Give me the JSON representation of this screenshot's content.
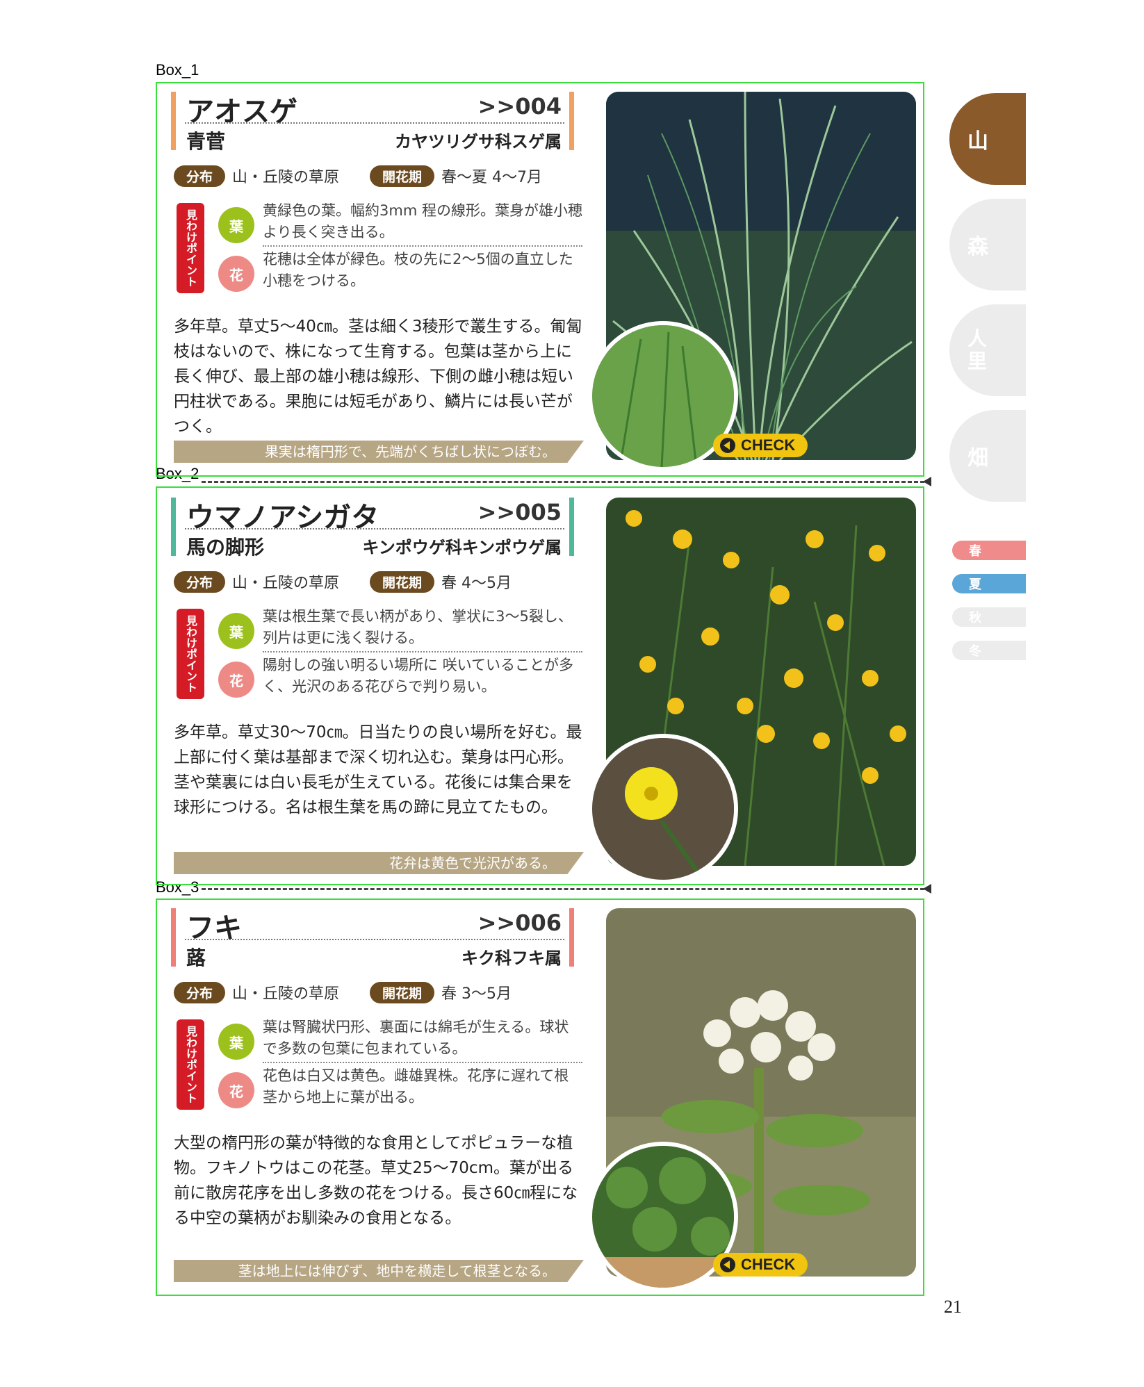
{
  "box_labels": [
    "Box_1",
    "Box_2",
    "Box_3"
  ],
  "common": {
    "dist_tag": "分布",
    "bloom_tag": "開花期",
    "point_label": "見わけポイント",
    "leaf_icon": "葉",
    "flower_icon": "花",
    "check_label": "CHECK"
  },
  "entries": [
    {
      "name": "アオスゲ",
      "number": ">>004",
      "kanji": "青菅",
      "family": "カヤツリグサ科スゲ属",
      "distribution": "山・丘陵の草原",
      "bloom": "春～夏 4～7月",
      "leaf_point": "黄緑色の葉。幅約3mm 程の線形。葉身が雄小穂より長く突き出る。",
      "flower_point": "花穂は全体が緑色。枝の先に2～5個の直立した小穂をつける。",
      "description": "多年草。草丈5～40㎝。茎は細く3稜形で叢生する。匍匐枝はないので、株になって生育する。包葉は茎から上に長く伸び、最上部の雄小穂は線形、下側の雌小穂は短い円柱状である。果胞には短毛があり、鱗片には長い芒がつく。",
      "ribbon": "果実は楕円形で、先端がくちばし状につぼむ。",
      "accent": "#f0a060"
    },
    {
      "name": "ウマノアシガタ",
      "number": ">>005",
      "kanji": "馬の脚形",
      "family": "キンポウゲ科キンポウゲ属",
      "distribution": "山・丘陵の草原",
      "bloom": "春 4～5月",
      "leaf_point": "葉は根生葉で長い柄があり、掌状に3～5裂し、列片は更に浅く裂ける。",
      "flower_point": "陽射しの強い明るい場所に 咲いていることが多く、光沢のある花びらで判り易い。",
      "description": "多年草。草丈30～70㎝。日当たりの良い場所を好む。最上部に付く葉は基部まで深く切れ込む。葉身は円心形。茎や葉裏には白い長毛が生えている。花後には集合果を球形につける。名は根生葉を馬の蹄に見立てたもの。",
      "ribbon": "花弁は黄色で光沢がある。",
      "accent": "#4fb89a"
    },
    {
      "name": "フキ",
      "number": ">>006",
      "kanji": "蕗",
      "family": "キク科フキ属",
      "distribution": "山・丘陵の草原",
      "bloom": "春 3～5月",
      "leaf_point": "葉は腎臓状円形、裏面には綿毛が生える。球状で多数の包葉に包まれている。",
      "flower_point": "花色は白又は黄色。雌雄異株。花序に遅れて根茎から地上に葉が出る。",
      "description": "大型の楕円形の葉が特徴的な食用としてポピュラーな植物。フキノトウはこの花茎。草丈25～70cm。葉が出る前に散房花序を出し多数の花をつける。長さ60㎝程になる中空の葉柄がお馴染みの食用となる。",
      "ribbon": "茎は地上には伸びず、地中を横走して根茎となる。",
      "accent": "#ee8078"
    }
  ],
  "side_tabs": [
    {
      "label": "山",
      "color": "#8a5a2b"
    },
    {
      "label": "森",
      "color": "#ececec"
    },
    {
      "label": "人里",
      "color": "#ececec"
    },
    {
      "label": "畑",
      "color": "#ececec"
    }
  ],
  "seasons": [
    {
      "label": "春",
      "color": "#ef8b8b"
    },
    {
      "label": "夏",
      "color": "#5aa6d8"
    },
    {
      "label": "秋",
      "color": "#ececec"
    },
    {
      "label": "冬",
      "color": "#ececec"
    }
  ],
  "page_number": "21"
}
